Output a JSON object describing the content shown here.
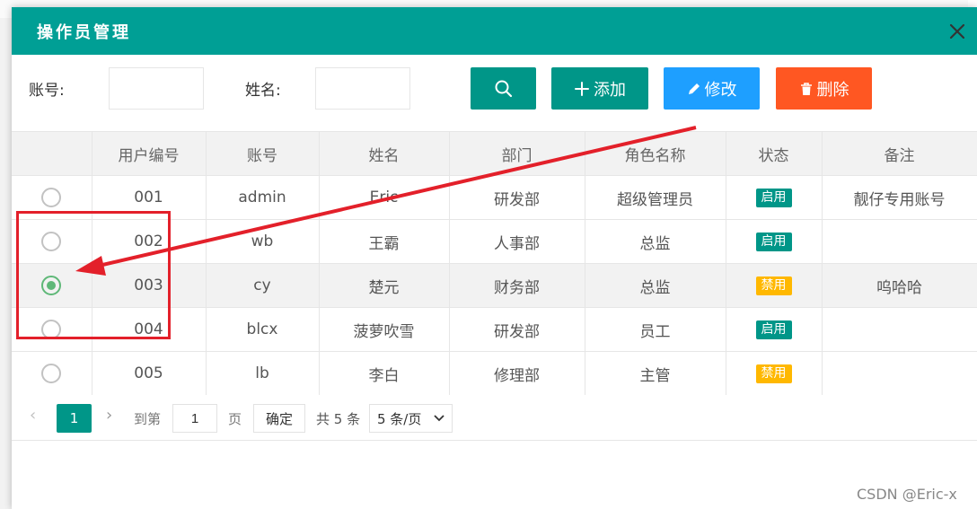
{
  "dialog": {
    "title": "操作员管理",
    "close_icon": "close-icon"
  },
  "search": {
    "account_label": "账号:",
    "account_value": "",
    "name_label": "姓名:",
    "name_value": ""
  },
  "toolbar": {
    "search_icon": "search-icon",
    "add_label": "添加",
    "edit_label": "修改",
    "delete_label": "删除"
  },
  "table": {
    "headers": [
      "",
      "用户编号",
      "账号",
      "姓名",
      "部门",
      "角色名称",
      "状态",
      "备注"
    ],
    "rows": [
      {
        "checked": false,
        "id": "001",
        "account": "admin",
        "name": "Eric",
        "dept": "研发部",
        "role": "超级管理员",
        "status": "启用",
        "status_type": "on",
        "remark": "靓仔专用账号"
      },
      {
        "checked": false,
        "id": "002",
        "account": "wb",
        "name": "王霸",
        "dept": "人事部",
        "role": "总监",
        "status": "启用",
        "status_type": "on",
        "remark": ""
      },
      {
        "checked": true,
        "id": "003",
        "account": "cy",
        "name": "楚元",
        "dept": "财务部",
        "role": "总监",
        "status": "禁用",
        "status_type": "off",
        "remark": "呜哈哈"
      },
      {
        "checked": false,
        "id": "004",
        "account": "blcx",
        "name": "菠萝吹雪",
        "dept": "研发部",
        "role": "员工",
        "status": "启用",
        "status_type": "on",
        "remark": ""
      },
      {
        "checked": false,
        "id": "005",
        "account": "lb",
        "name": "李白",
        "dept": "修理部",
        "role": "主管",
        "status": "禁用",
        "status_type": "off",
        "remark": ""
      }
    ]
  },
  "pager": {
    "current_page": "1",
    "goto_label": "到第",
    "goto_value": "1",
    "page_unit": "页",
    "confirm_label": "确定",
    "total_text": "共 5 条",
    "page_size": "5 条/页"
  },
  "colors": {
    "header": "#009f95",
    "primary": "#009688",
    "edit": "#1e9fff",
    "danger": "#ff5722",
    "warn": "#ffb800",
    "radio_checked": "#5fb878",
    "annotation": "#e3202a"
  },
  "watermark": "CSDN @Eric-x"
}
